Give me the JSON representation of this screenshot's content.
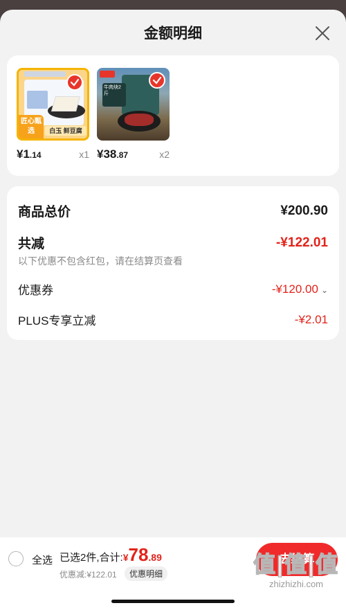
{
  "sheet": {
    "title": "金额明细"
  },
  "products": [
    {
      "name": "白玉 鲜豆腐",
      "badge": "匠心甄选",
      "price_int": "¥1",
      "price_dec": ".14",
      "qty": "x1"
    },
    {
      "name": "牛肉块2斤",
      "price_int": "¥38",
      "price_dec": ".87",
      "qty": "x2"
    }
  ],
  "summary": {
    "goods_total_label": "商品总价",
    "goods_total_value": "¥200.90",
    "reduce_label": "共减",
    "reduce_value": "-¥122.01",
    "note": "以下优惠不包含红包，请在结算页查看",
    "coupon_label": "优惠券",
    "coupon_value": "-¥120.00",
    "plus_label": "PLUS专享立减",
    "plus_value": "-¥2.01"
  },
  "bottom": {
    "select_all": "全选",
    "selected_text": "已选2件,合计:",
    "currency": "¥",
    "amount_int": "78",
    "amount_dec": ".89",
    "discount_text": "优惠减:¥122.01",
    "detail_label": "优惠明细",
    "checkout_label": "去结算"
  },
  "watermark": {
    "logo": "值|值|值",
    "url": "zhizhizhi.com"
  },
  "colors": {
    "accent": "#e2231a",
    "checkout": "#f02a2a"
  }
}
